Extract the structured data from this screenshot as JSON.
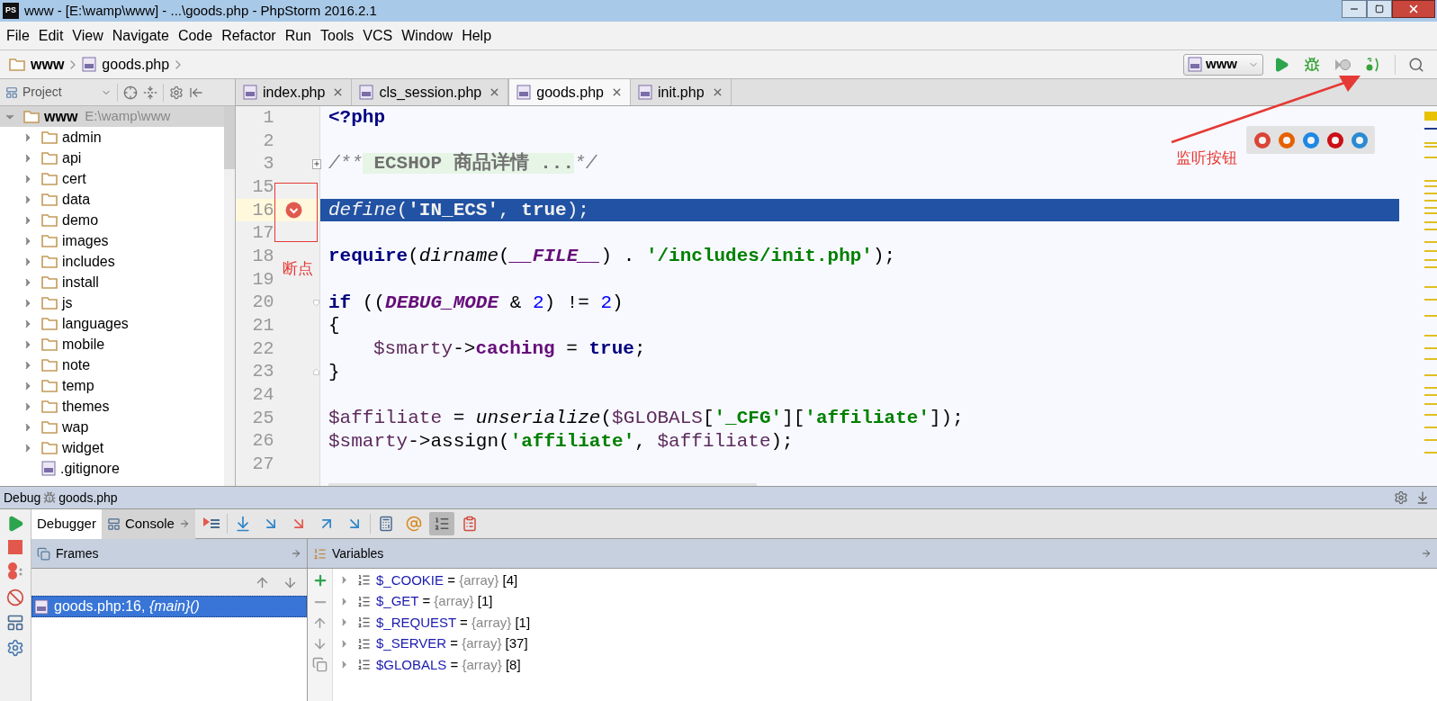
{
  "window": {
    "app_icon_text": "PS",
    "title": "www - [E:\\wamp\\www] - ...\\goods.php - PhpStorm 2016.2.1"
  },
  "menu": [
    {
      "label": "File"
    },
    {
      "label": "Edit"
    },
    {
      "label": "View"
    },
    {
      "label": "Navigate"
    },
    {
      "label": "Code"
    },
    {
      "label": "Refactor"
    },
    {
      "label": "Run"
    },
    {
      "label": "Tools"
    },
    {
      "label": "VCS"
    },
    {
      "label": "Window"
    },
    {
      "label": "Help"
    }
  ],
  "navbar": {
    "breadcrumbs": [
      {
        "label": "www",
        "kind": "folder"
      },
      {
        "label": "goods.php",
        "kind": "file"
      }
    ],
    "run_config": "www"
  },
  "project_panel": {
    "title": "Project",
    "tree": [
      {
        "label": "www",
        "path": "E:\\wamp\\www",
        "kind": "folder",
        "expanded": true,
        "selected": true,
        "children": [
          {
            "label": "admin",
            "kind": "folder",
            "expanded": false,
            "selected": false
          },
          {
            "label": "api",
            "kind": "folder",
            "expanded": false,
            "selected": false
          },
          {
            "label": "cert",
            "kind": "folder",
            "expanded": false,
            "selected": false
          },
          {
            "label": "data",
            "kind": "folder",
            "expanded": false,
            "selected": false
          },
          {
            "label": "demo",
            "kind": "folder",
            "expanded": false,
            "selected": false
          },
          {
            "label": "images",
            "kind": "folder",
            "expanded": false,
            "selected": false
          },
          {
            "label": "includes",
            "kind": "folder",
            "expanded": false,
            "selected": false
          },
          {
            "label": "install",
            "kind": "folder",
            "expanded": false,
            "selected": false
          },
          {
            "label": "js",
            "kind": "folder",
            "expanded": false,
            "selected": false
          },
          {
            "label": "languages",
            "kind": "folder",
            "expanded": false,
            "selected": false
          },
          {
            "label": "mobile",
            "kind": "folder",
            "expanded": false,
            "selected": false
          },
          {
            "label": "note",
            "kind": "folder",
            "expanded": false,
            "selected": false
          },
          {
            "label": "temp",
            "kind": "folder",
            "expanded": false,
            "selected": false
          },
          {
            "label": "themes",
            "kind": "folder",
            "expanded": false,
            "selected": false
          },
          {
            "label": "wap",
            "kind": "folder",
            "expanded": false,
            "selected": false
          },
          {
            "label": "widget",
            "kind": "folder",
            "expanded": false,
            "selected": false
          },
          {
            "label": ".gitignore",
            "kind": "file",
            "expanded": false,
            "selected": false
          }
        ]
      }
    ]
  },
  "editor_tabs": [
    {
      "label": "index.php",
      "selected": false
    },
    {
      "label": "cls_session.php",
      "selected": false
    },
    {
      "label": "goods.php",
      "selected": true
    },
    {
      "label": "init.php",
      "selected": false
    }
  ],
  "code_lines": [
    {
      "number": "1",
      "highlighted": false,
      "tokens": [
        {
          "kind": "keyword",
          "text": "<?php"
        }
      ]
    },
    {
      "number": "2",
      "highlighted": false
    },
    {
      "number": "3",
      "highlighted": false,
      "fold_collapsed": true,
      "tokens": [
        {
          "kind": "comment",
          "text": "/**"
        },
        {
          "kind": "folded",
          "text": " ECSHOP 商品详情 ..."
        },
        {
          "kind": "comment",
          "text": "*/"
        }
      ]
    },
    {
      "number": "15",
      "highlighted": false
    },
    {
      "number": "16",
      "breakpoint": true,
      "highlighted": true,
      "tokens": [
        {
          "kind": "function",
          "text": "define"
        },
        {
          "kind": "plain",
          "text": "("
        },
        {
          "kind": "string",
          "text": "'IN_ECS'"
        },
        {
          "kind": "plain",
          "text": ", "
        },
        {
          "kind": "keyword",
          "text": "true"
        },
        {
          "kind": "plain",
          "text": ");"
        }
      ]
    },
    {
      "number": "17",
      "highlighted": false
    },
    {
      "number": "18",
      "highlighted": false,
      "tokens": [
        {
          "kind": "keyword",
          "text": "require"
        },
        {
          "kind": "plain",
          "text": "("
        },
        {
          "kind": "function",
          "text": "dirname"
        },
        {
          "kind": "plain",
          "text": "("
        },
        {
          "kind": "constant",
          "text": "__FILE__"
        },
        {
          "kind": "plain",
          "text": ") . "
        },
        {
          "kind": "string",
          "text": "'/includes/init.php'"
        },
        {
          "kind": "plain",
          "text": ");"
        }
      ]
    },
    {
      "number": "19",
      "highlighted": false
    },
    {
      "number": "20",
      "highlighted": false,
      "fold_start": true,
      "tokens": [
        {
          "kind": "keyword",
          "text": "if"
        },
        {
          "kind": "plain",
          "text": " (("
        },
        {
          "kind": "constant",
          "text": "DEBUG_MODE"
        },
        {
          "kind": "plain",
          "text": " & "
        },
        {
          "kind": "number",
          "text": "2"
        },
        {
          "kind": "plain",
          "text": ") != "
        },
        {
          "kind": "number",
          "text": "2"
        },
        {
          "kind": "plain",
          "text": ")"
        }
      ]
    },
    {
      "number": "21",
      "highlighted": false,
      "tokens": [
        {
          "kind": "plain",
          "text": "{"
        }
      ]
    },
    {
      "number": "22",
      "highlighted": false,
      "indent": true,
      "tokens": [
        {
          "kind": "variable",
          "text": "$smarty"
        },
        {
          "kind": "plain",
          "text": "->"
        },
        {
          "kind": "field",
          "text": "caching"
        },
        {
          "kind": "plain",
          "text": " = "
        },
        {
          "kind": "keyword",
          "text": "true"
        },
        {
          "kind": "plain",
          "text": ";"
        }
      ]
    },
    {
      "number": "23",
      "highlighted": false,
      "fold_end": true,
      "tokens": [
        {
          "kind": "plain",
          "text": "}"
        }
      ]
    },
    {
      "number": "24",
      "highlighted": false
    },
    {
      "number": "25",
      "highlighted": false,
      "tokens": [
        {
          "kind": "variable",
          "text": "$affiliate"
        },
        {
          "kind": "plain",
          "text": " = "
        },
        {
          "kind": "function",
          "text": "unserialize"
        },
        {
          "kind": "plain",
          "text": "("
        },
        {
          "kind": "variable",
          "text": "$GLOBALS"
        },
        {
          "kind": "plain",
          "text": "["
        },
        {
          "kind": "string",
          "text": "'_CFG'"
        },
        {
          "kind": "plain",
          "text": "]["
        },
        {
          "kind": "string",
          "text": "'affiliate'"
        },
        {
          "kind": "plain",
          "text": "]);"
        }
      ]
    },
    {
      "number": "26",
      "highlighted": false,
      "tokens": [
        {
          "kind": "variable",
          "text": "$smarty"
        },
        {
          "kind": "plain",
          "text": "->assign("
        },
        {
          "kind": "string",
          "text": "'affiliate'"
        },
        {
          "kind": "plain",
          "text": ", "
        },
        {
          "kind": "variable",
          "text": "$affiliate"
        },
        {
          "kind": "plain",
          "text": ");"
        }
      ]
    },
    {
      "number": "27",
      "highlighted": false
    }
  ],
  "annotations": [
    {
      "kind": "breakpoint_note",
      "text": "断点"
    },
    {
      "kind": "listen_note",
      "text": "监听按钮"
    }
  ],
  "debug": {
    "title": "Debug",
    "session": "goods.php",
    "tabs": [
      {
        "label": "Debugger",
        "selected": true
      },
      {
        "label": "Console",
        "selected": false
      }
    ],
    "frames_title": "Frames",
    "frames": [
      {
        "text": "goods.php:16, *{main}()*",
        "selected": true
      }
    ],
    "variables_title": "Variables",
    "variables": [
      {
        "name": "$_COOKIE",
        "op": "=",
        "type": "{array}",
        "count": "[4]"
      },
      {
        "name": "$_GET",
        "op": "=",
        "type": "{array}",
        "count": "[1]"
      },
      {
        "name": "$_REQUEST",
        "op": "=",
        "type": "{array}",
        "count": "[1]"
      },
      {
        "name": "$_SERVER",
        "op": "=",
        "type": "{array}",
        "count": "[37]"
      },
      {
        "name": "$GLOBALS",
        "op": "=",
        "type": "{array}",
        "count": "[8]"
      }
    ]
  }
}
